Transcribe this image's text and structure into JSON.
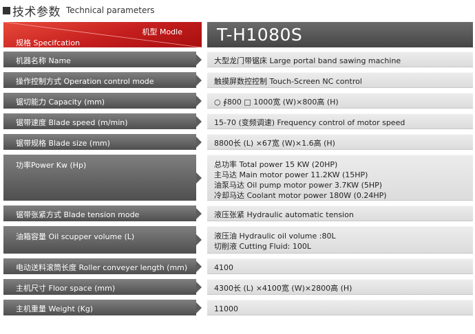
{
  "header": {
    "title_zh": "技术参数",
    "title_en": "Technical parameters"
  },
  "table": {
    "model_label": "机型 Modle",
    "spec_label": "规格 Specifcation",
    "model_value": "T-H1080S",
    "rows": [
      {
        "label": "机器名称 Name",
        "values": [
          "大型龙门带锯床 Large portal band sawing machine"
        ]
      },
      {
        "label": "操作控制方式 Operation control mode",
        "values": [
          "触摸屏数控控制 Touch-Screen NC control"
        ]
      },
      {
        "label": "锯切能力 Capacity (mm)",
        "values": [
          "○ ∮800   □ 1000宽 (W)×800高 (H)"
        ]
      },
      {
        "label": "锯带速度 Blade  speed (m/min)",
        "values": [
          "15-70 (变频调速) Frequency control of motor speed"
        ]
      },
      {
        "label": "锯带规格 Blade  size (mm)",
        "values": [
          "8800长 (L) ×67宽 (W)×1.6高 (H)"
        ]
      },
      {
        "label": "功率Power  Kw (Hp)",
        "values": [
          "总功率 Total power 15 KW (20HP)",
          "主马达 Main motor power 11.2KW (15HP)",
          "油泵马达 Oil pump motor power 3.7KW (5HP)",
          "冷却马达 Coolant motor power 180W (0.24HP)"
        ]
      },
      {
        "label": "锯带张紧方式 Blade tension mode",
        "values": [
          "液压张紧 Hydraulic automatic tension"
        ]
      },
      {
        "label": "油箱容量 Oil scupper volume (L)",
        "values": [
          "液压油 Hydraulic oil volume :80L",
          "切削液 Cutting Fluid: 100L"
        ]
      },
      {
        "label": "电动送料滚筒长度 Roller conveyer length (mm)",
        "values": [
          "4100"
        ]
      },
      {
        "label": "主机尺寸 Floor space (mm)",
        "values": [
          "4300长 (L) ×4100宽 (W)×2800高 (H)"
        ]
      },
      {
        "label": "主机重量 Weight (Kg)",
        "values": [
          "11000"
        ]
      }
    ]
  }
}
